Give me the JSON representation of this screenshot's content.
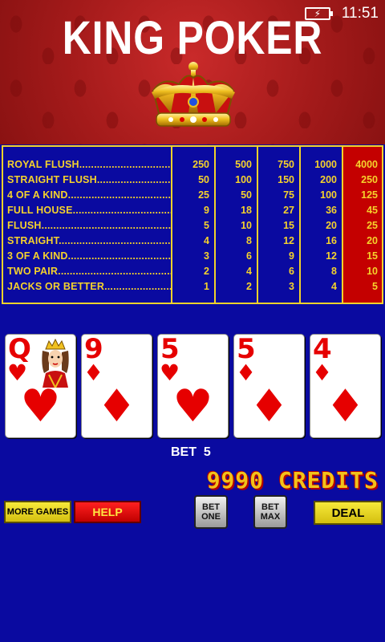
{
  "status": {
    "time": "11:51",
    "battery_icon": "battery-charging-icon"
  },
  "title": "KING POKER",
  "paytable": {
    "hands": [
      "ROYAL FLUSH",
      "STRAIGHT FLUSH",
      "4 OF A KIND",
      "FULL HOUSE",
      "FLUSH",
      "STRAIGHT",
      "3 OF A KIND",
      "TWO PAIR",
      "JACKS OR BETTER"
    ],
    "leader": "................................................",
    "columns": [
      [
        "250",
        "50",
        "25",
        "9",
        "5",
        "4",
        "3",
        "2",
        "1"
      ],
      [
        "500",
        "100",
        "50",
        "18",
        "10",
        "8",
        "6",
        "4",
        "2"
      ],
      [
        "750",
        "150",
        "75",
        "27",
        "15",
        "12",
        "9",
        "6",
        "3"
      ],
      [
        "1000",
        "200",
        "100",
        "36",
        "20",
        "16",
        "12",
        "8",
        "4"
      ],
      [
        "4000",
        "250",
        "125",
        "45",
        "25",
        "20",
        "15",
        "10",
        "5"
      ]
    ],
    "highlight_color": "#c40000",
    "text_color": "#f5d22c"
  },
  "cards": [
    {
      "rank": "Q",
      "suit": "♥",
      "color": "red"
    },
    {
      "rank": "9",
      "suit": "♦",
      "color": "red"
    },
    {
      "rank": "5",
      "suit": "♥",
      "color": "red"
    },
    {
      "rank": "5",
      "suit": "♦",
      "color": "red"
    },
    {
      "rank": "4",
      "suit": "♦",
      "color": "red"
    }
  ],
  "bet": {
    "label": "BET",
    "value": "5"
  },
  "credits": {
    "value": "9990",
    "label": "CREDITS"
  },
  "buttons": {
    "more_games": "MORE GAMES",
    "help": "HELP",
    "bet_one_line1": "BET",
    "bet_one_line2": "ONE",
    "bet_max_line1": "BET",
    "bet_max_line2": "MAX",
    "deal": "DEAL"
  }
}
